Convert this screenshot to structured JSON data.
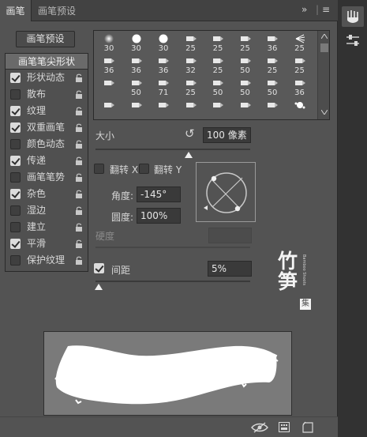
{
  "tabs": {
    "active": "画笔",
    "inactive": "画笔预设",
    "close": "✕",
    "expand": "»",
    "menu": "≡"
  },
  "preset_button": "画笔预设",
  "options": {
    "header": "画笔笔尖形状",
    "items": [
      {
        "label": "形状动态",
        "checked": true
      },
      {
        "label": "散布",
        "checked": false
      },
      {
        "label": "纹理",
        "checked": true
      },
      {
        "label": "双重画笔",
        "checked": true
      },
      {
        "label": "颜色动态",
        "checked": false
      },
      {
        "label": "传递",
        "checked": true
      },
      {
        "label": "画笔笔势",
        "checked": false
      },
      {
        "label": "杂色",
        "checked": true
      },
      {
        "label": "湿边",
        "checked": false
      },
      {
        "label": "建立",
        "checked": false
      },
      {
        "label": "平滑",
        "checked": true
      },
      {
        "label": "保护纹理",
        "checked": false
      }
    ]
  },
  "brush_grid": {
    "rows": [
      [
        "30",
        "30",
        "30",
        "25",
        "25",
        "25",
        "36",
        "25"
      ],
      [
        "36",
        "36",
        "36",
        "32",
        "25",
        "50",
        "25",
        "25"
      ],
      [
        "",
        "50",
        "71",
        "25",
        "50",
        "50",
        "50",
        "36"
      ],
      [
        "",
        "",
        "",
        "",
        "",
        "",
        "",
        ""
      ]
    ]
  },
  "size": {
    "label": "大小",
    "value": "100 像素",
    "reset_icon": "↺",
    "level": 0.6
  },
  "flip_x": {
    "label": "翻转 X",
    "checked": false
  },
  "flip_y": {
    "label": "翻转 Y",
    "checked": false
  },
  "angle": {
    "label": "角度:",
    "value": "-145°"
  },
  "roundness": {
    "label": "圆度:",
    "value": "100%"
  },
  "hardness": {
    "label": "硬度",
    "value": ""
  },
  "spacing": {
    "label": "间距",
    "checked": true,
    "value": "5%",
    "level": 0.02
  },
  "watermark": {
    "big": "竹笋",
    "small": "集",
    "side": "Bamboo Shoots"
  }
}
